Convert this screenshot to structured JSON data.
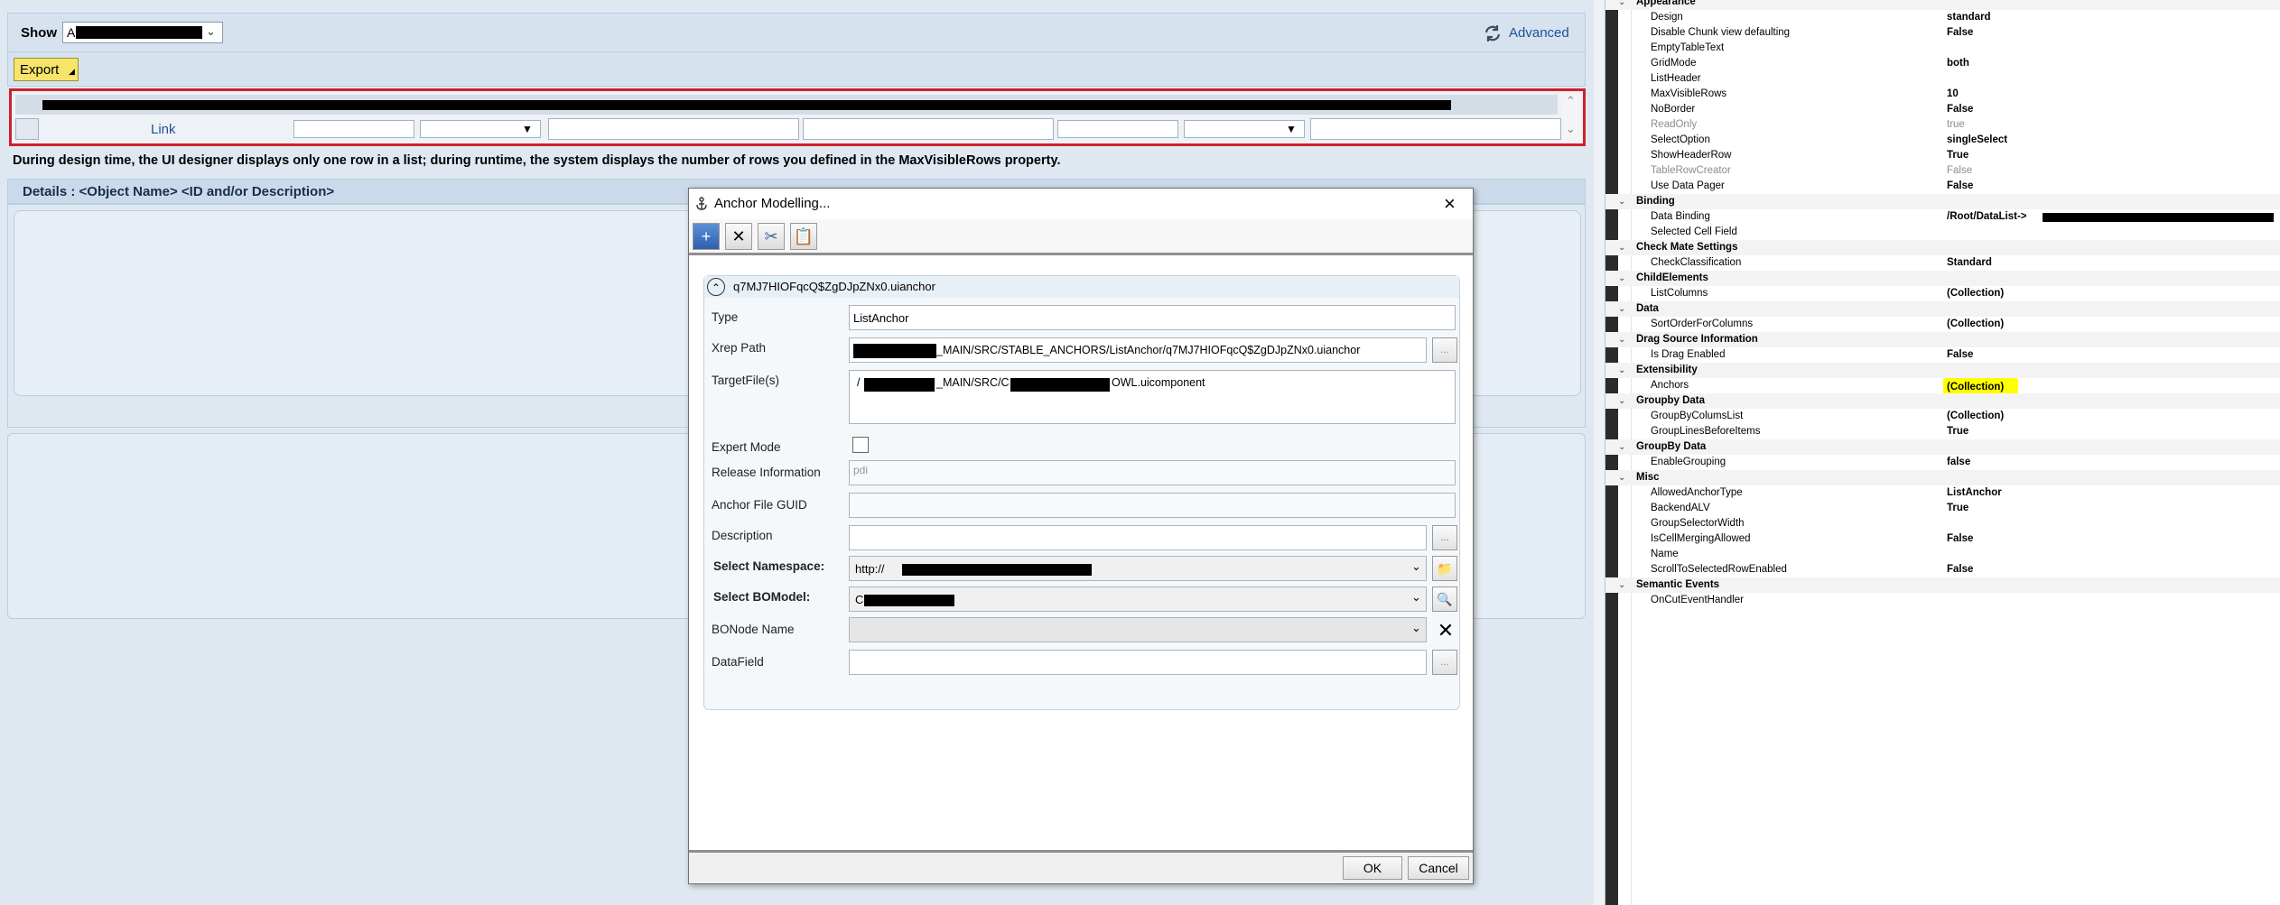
{
  "designer": {
    "show_label": "Show",
    "show_select_text": "A",
    "advanced_label": "Advanced",
    "export_label": "Export",
    "link_label": "Link",
    "info_text": "During design time, the UI designer displays only one row in a list; during runtime, the system displays the number of rows you defined in the MaxVisibleRows property.",
    "details_title": "Details : <Object Name> <ID and/or Description>"
  },
  "dialog": {
    "title": "Anchor Modelling...",
    "section_title": "q7MJ7HIOFqcQ$ZgDJpZNx0.uianchor",
    "fields": {
      "type_label": "Type",
      "type_value": "ListAnchor",
      "xrep_label": "Xrep Path",
      "xrep_value": "_MAIN/SRC/STABLE_ANCHORS/ListAnchor/q7MJ7HIOFqcQ$ZgDJpZNx0.uianchor",
      "target_label": "TargetFile(s)",
      "target_prefix": "/",
      "target_mid": "_MAIN/SRC/C",
      "target_suffix": "OWL.uicomponent",
      "expert_label": "Expert Mode",
      "release_label": "Release Information",
      "release_value": "pdi",
      "guid_label": "Anchor File GUID",
      "description_label": "Description",
      "namespace_label": "Select Namespace:",
      "namespace_value": "http://",
      "bomodel_label": "Select BOModel:",
      "bomodel_value": "C",
      "bonode_label": "BONode Name",
      "datafield_label": "DataField",
      "ellipsis": "..."
    },
    "ok_label": "OK",
    "cancel_label": "Cancel"
  },
  "properties": {
    "rows": [
      {
        "kind": "cat",
        "name": "Appearance"
      },
      {
        "kind": "prop",
        "name": "Design",
        "value": "standard"
      },
      {
        "kind": "prop",
        "name": "Disable Chunk view defaulting",
        "value": "False"
      },
      {
        "kind": "prop",
        "name": "EmptyTableText",
        "value": ""
      },
      {
        "kind": "prop",
        "name": "GridMode",
        "value": "both"
      },
      {
        "kind": "prop",
        "name": "ListHeader",
        "value": ""
      },
      {
        "kind": "prop",
        "name": "MaxVisibleRows",
        "value": "10"
      },
      {
        "kind": "prop",
        "name": "NoBorder",
        "value": "False"
      },
      {
        "kind": "propgray",
        "name": "ReadOnly",
        "value": "true"
      },
      {
        "kind": "prop",
        "name": "SelectOption",
        "value": "singleSelect"
      },
      {
        "kind": "prop",
        "name": "ShowHeaderRow",
        "value": "True"
      },
      {
        "kind": "propgray",
        "name": "TableRowCreator",
        "value": "False"
      },
      {
        "kind": "prop",
        "name": "Use Data Pager",
        "value": "False"
      },
      {
        "kind": "cat",
        "name": "Binding"
      },
      {
        "kind": "prop",
        "name": "Data Binding",
        "value": "/Root/DataList->"
      },
      {
        "kind": "prop",
        "name": "Selected Cell Field",
        "value": ""
      },
      {
        "kind": "cat",
        "name": "Check Mate Settings"
      },
      {
        "kind": "prop",
        "name": "CheckClassification",
        "value": "Standard"
      },
      {
        "kind": "cat",
        "name": "ChildElements"
      },
      {
        "kind": "prop",
        "name": "ListColumns",
        "value": "(Collection)"
      },
      {
        "kind": "cat",
        "name": "Data"
      },
      {
        "kind": "prop",
        "name": "SortOrderForColumns",
        "value": "(Collection)"
      },
      {
        "kind": "cat",
        "name": "Drag Source Information"
      },
      {
        "kind": "prop",
        "name": "Is Drag Enabled",
        "value": "False"
      },
      {
        "kind": "cat",
        "name": "Extensibility"
      },
      {
        "kind": "prop",
        "name": "Anchors",
        "value": "(Collection)",
        "highlight": true
      },
      {
        "kind": "cat",
        "name": "Groupby Data"
      },
      {
        "kind": "prop",
        "name": "GroupByColumsList",
        "value": "(Collection)"
      },
      {
        "kind": "prop",
        "name": "GroupLinesBeforeItems",
        "value": "True"
      },
      {
        "kind": "cat",
        "name": "GroupBy Data"
      },
      {
        "kind": "prop",
        "name": "EnableGrouping",
        "value": "false"
      },
      {
        "kind": "cat",
        "name": "Misc"
      },
      {
        "kind": "prop",
        "name": "AllowedAnchorType",
        "value": "ListAnchor"
      },
      {
        "kind": "prop",
        "name": "BackendALV",
        "value": "True"
      },
      {
        "kind": "prop",
        "name": "GroupSelectorWidth",
        "value": ""
      },
      {
        "kind": "prop",
        "name": "IsCellMergingAllowed",
        "value": "False"
      },
      {
        "kind": "prop",
        "name": "Name",
        "value": ""
      },
      {
        "kind": "prop",
        "name": "ScrollToSelectedRowEnabled",
        "value": "False"
      },
      {
        "kind": "cat",
        "name": "Semantic Events"
      },
      {
        "kind": "prop",
        "name": "OnCutEventHandler",
        "value": ""
      }
    ]
  },
  "colors": {
    "highlight": "#ffff00",
    "designer_bg": "#dfe8f1",
    "link": "#1f4e99",
    "red_border": "#d0202a"
  }
}
